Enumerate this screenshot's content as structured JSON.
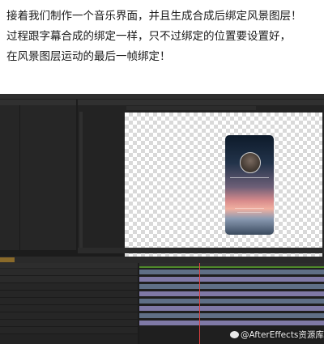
{
  "caption": {
    "lines": [
      "接着我们制作一个音乐界面，并且生成合成后绑定风景图层！",
      "过程跟字幕合成的绑定一样，只不过绑定的位置要设置好，",
      "在风景图层运动的最后一帧绑定！"
    ]
  },
  "watermark": {
    "text": "@AfterEffects资源库"
  },
  "colors": {
    "ui_background": "#1c1c1c",
    "panel": "#262626",
    "playhead": "#e04040",
    "track_gray": "#5f6f86",
    "track_purple": "#7f79a6",
    "work_area": "#4f8a2a"
  },
  "timeline": {
    "playhead_fraction": 0.32
  }
}
